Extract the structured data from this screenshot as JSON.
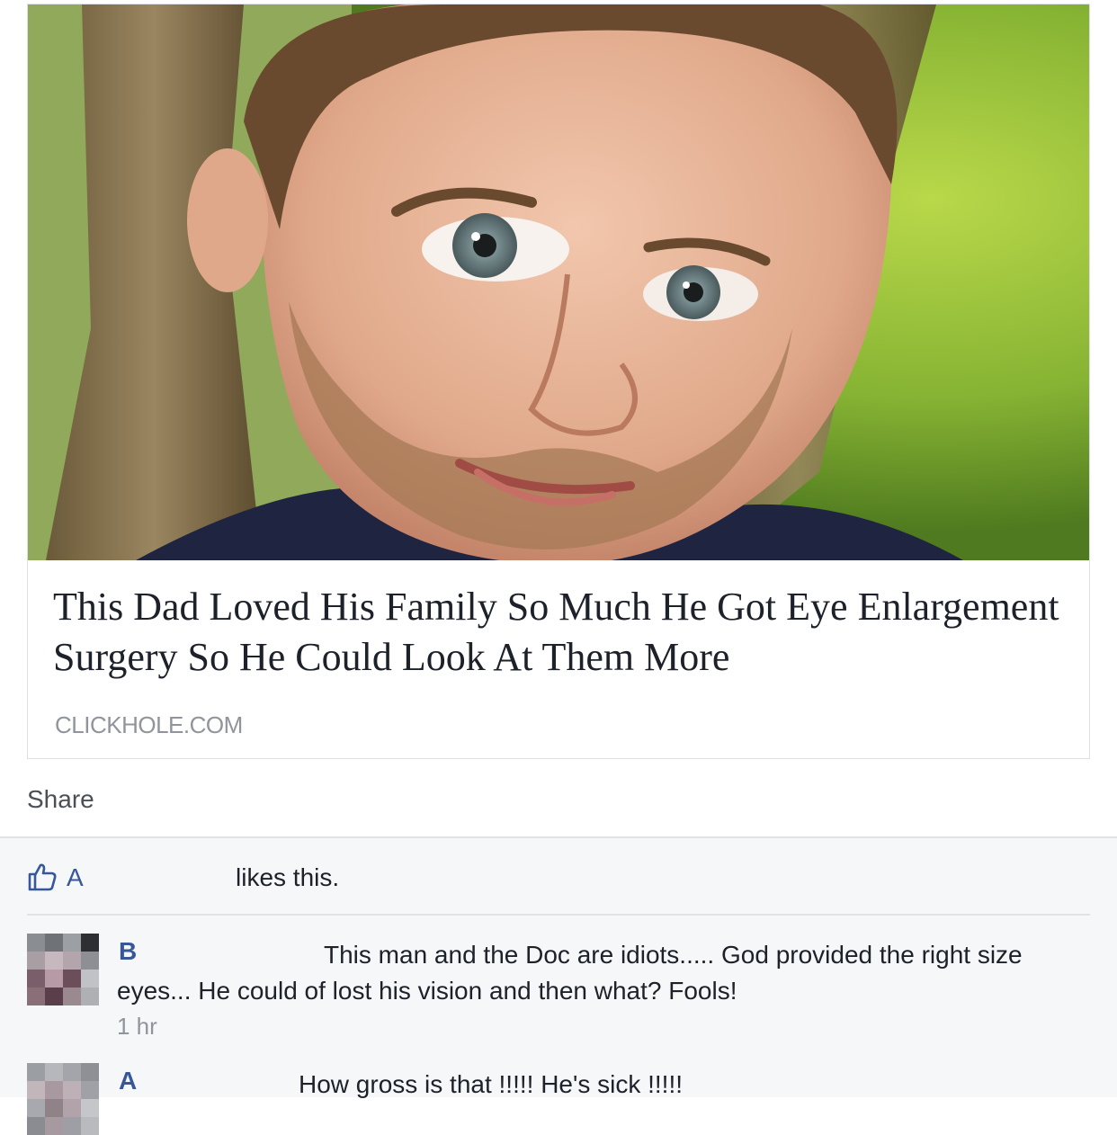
{
  "link": {
    "title": "This Dad Loved His Family So Much He Got Eye Enlargement Surgery So He Could Look At Them More",
    "domain": "CLICKHOLE.COM"
  },
  "actions": {
    "share_label": "Share"
  },
  "likes": {
    "liker": "A",
    "text": "likes this."
  },
  "comments": [
    {
      "author": "B",
      "text": "This man and the Doc are idiots..... God provided the right size eyes... He could of lost his vision and then what? Fools!",
      "time": "1 hr"
    },
    {
      "author": "A",
      "text": "How gross is that !!!!! He's sick !!!!!"
    }
  ],
  "colors": {
    "link_blue": "#365899",
    "meta_gray": "#90949c",
    "ufi_bg": "#f6f7f9"
  },
  "icons": {
    "like": "thumbs-up-icon"
  }
}
